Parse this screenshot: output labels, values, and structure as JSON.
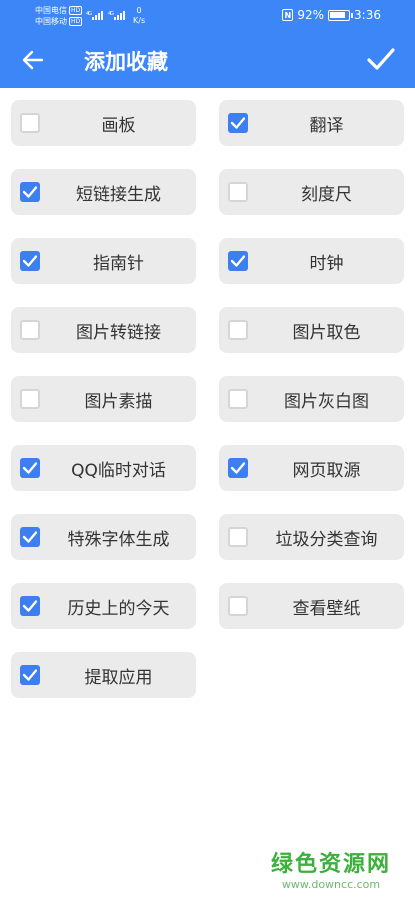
{
  "status_bar": {
    "carrier1": "中国电信",
    "carrier2": "中国移动",
    "hd": "HD",
    "speed_value": "0",
    "speed_unit": "K/s",
    "battery_percent": "92%",
    "battery_level": 0.92,
    "time": "3:36"
  },
  "header": {
    "title": "添加收藏",
    "back_icon": "arrow-left-icon",
    "confirm_icon": "checkmark-icon"
  },
  "accent_color": "#3d86f7",
  "items": [
    {
      "label": "画板",
      "checked": false
    },
    {
      "label": "翻译",
      "checked": true
    },
    {
      "label": "短链接生成",
      "checked": true
    },
    {
      "label": "刻度尺",
      "checked": false
    },
    {
      "label": "指南针",
      "checked": true
    },
    {
      "label": "时钟",
      "checked": true
    },
    {
      "label": "图片转链接",
      "checked": false
    },
    {
      "label": "图片取色",
      "checked": false
    },
    {
      "label": "图片素描",
      "checked": false
    },
    {
      "label": "图片灰白图",
      "checked": false
    },
    {
      "label": "QQ临时对话",
      "checked": true
    },
    {
      "label": "网页取源",
      "checked": true
    },
    {
      "label": "特殊字体生成",
      "checked": true
    },
    {
      "label": "垃圾分类查询",
      "checked": false
    },
    {
      "label": "历史上的今天",
      "checked": true
    },
    {
      "label": "查看壁纸",
      "checked": false
    },
    {
      "label": "提取应用",
      "checked": true
    }
  ],
  "watermark": {
    "line1": "绿色资源网",
    "line2": "www.downcc.com"
  }
}
